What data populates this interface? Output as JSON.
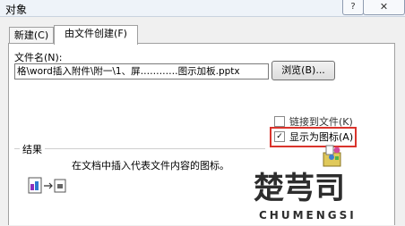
{
  "window": {
    "title": "对象",
    "help_label": "?",
    "close_label": "✕"
  },
  "tabs": [
    {
      "label": "新建(C)",
      "active": false
    },
    {
      "label": "由文件创建(F)",
      "active": true
    }
  ],
  "form": {
    "filename_label": "文件名(N):",
    "filename_value": "格\\word插入附件\\附一\\1、屏…………图示加板.pptx",
    "browse_label": "浏览(B)...",
    "link_label": "链接到文件(K)",
    "link_checked": false,
    "display_icon_label": "显示为图标(A)",
    "display_icon_checked": true
  },
  "result": {
    "label": "结果",
    "text": "在文档中插入代表文件内容的图标。"
  },
  "watermark": {
    "text": "楚芎司",
    "subtext": "CHUMENGSI"
  },
  "colors": {
    "highlight": "#d9342c",
    "watermark": "#2d2d2d"
  },
  "icons": {
    "help": "help-icon",
    "close": "close-icon",
    "check": "check-icon",
    "package": "package-icon",
    "insert": "insert-object-icon"
  }
}
